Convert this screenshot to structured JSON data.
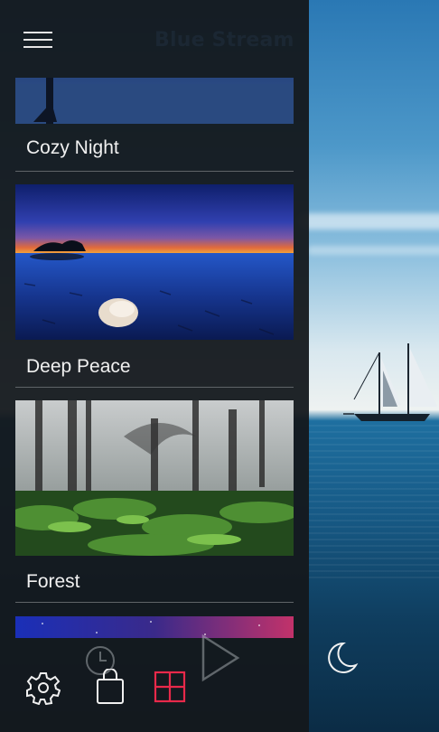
{
  "app": {
    "title": "Blue Stream"
  },
  "sounds": [
    {
      "label": "Cozy Night",
      "thumbnail": "beach-night-footprints"
    },
    {
      "label": "Deep Peace",
      "thumbnail": "lake-sunset-shell"
    },
    {
      "label": "Forest",
      "thumbnail": "misty-forest-ferns"
    },
    {
      "label": "",
      "thumbnail": "galaxy-stars"
    }
  ],
  "icons": {
    "menu": "hamburger-menu-icon",
    "timer": "clock-icon",
    "play": "play-icon",
    "night_mode": "moon-icon",
    "settings": "gear-icon",
    "store": "shopping-bag-icon",
    "grid_view": "grid-icon"
  },
  "colors": {
    "accent": "#e8294a",
    "panel_bg": "#14181c",
    "text": "#f0f0f0"
  }
}
